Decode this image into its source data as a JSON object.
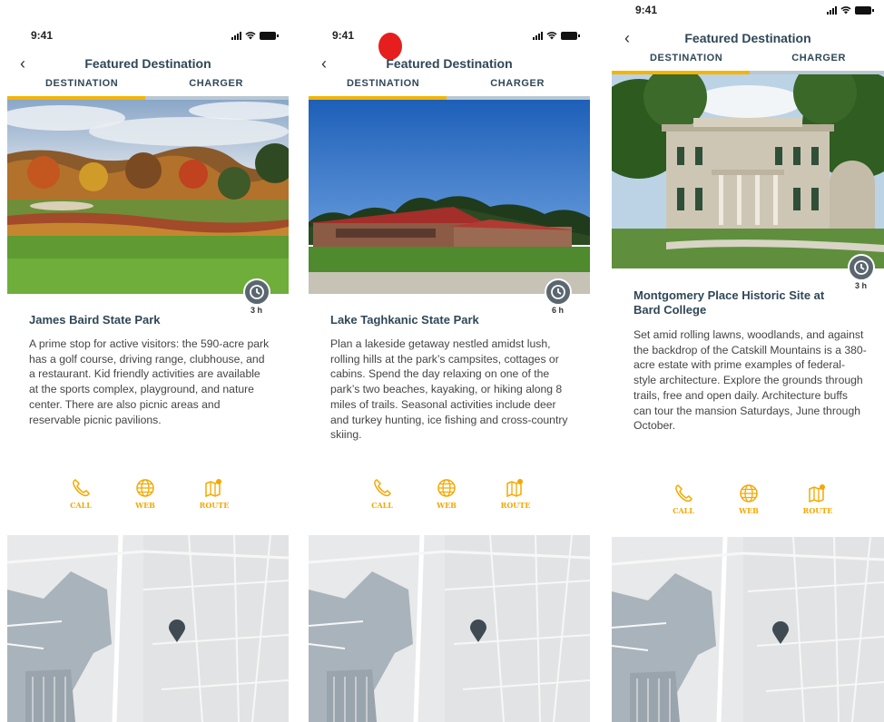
{
  "screens": [
    {
      "time": "9:41",
      "title": "Featured Destination",
      "tabs": [
        "DESTINATION",
        "CHARGER"
      ],
      "hours": "3 h",
      "park_title": "James Baird State Park",
      "description": "A prime stop for active visitors: the 590-acre park has a golf course, driving range, clubhouse, and a restaurant. Kid friendly activities are available at the sports complex, playground, and nature center. There are also picnic areas and reservable picnic pavilions.",
      "actions": [
        "CALL",
        "WEB",
        "ROUTE"
      ]
    },
    {
      "time": "9:41",
      "title": "Featured Destination",
      "tabs": [
        "DESTINATION",
        "CHARGER"
      ],
      "hours": "6 h",
      "park_title": "Lake Taghkanic State Park",
      "description": "Plan a lakeside getaway nestled amidst lush, rolling hills at the park’s campsites, cottages or cabins. Spend the day relaxing on one of the park’s two beaches, kayaking, or hiking along 8 miles of trails. Seasonal activities include deer and turkey hunting, ice fishing and cross-country skiing.",
      "actions": [
        "CALL",
        "WEB",
        "ROUTE"
      ]
    },
    {
      "time": "9:41",
      "title": "Featured Destination",
      "tabs": [
        "DESTINATION",
        "CHARGER"
      ],
      "hours": "3 h",
      "park_title": "Montgomery Place Historic Site at Bard College",
      "description": "Set amid rolling lawns, woodlands, and against the backdrop of the Catskill Mountains is a 380-acre estate with prime examples of federal-style architecture.  Explore the grounds through trails, free and open daily. Architecture buffs can tour the mansion Saturdays, June through October.",
      "actions": [
        "CALL",
        "WEB",
        "ROUTE"
      ]
    }
  ],
  "colors": {
    "accent": "#f5b400",
    "title": "#2f4757",
    "tab_track": "#b9c7d2",
    "clock": "#5b6770",
    "marker": "#e61e1e"
  },
  "icons": [
    "back-chevron",
    "clock-icon",
    "phone-icon",
    "globe-icon",
    "map-route-icon",
    "map-pin-icon"
  ]
}
